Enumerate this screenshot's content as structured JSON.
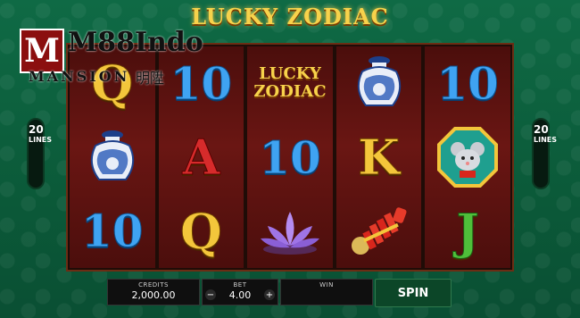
{
  "game_title": "LUCKY ZODIAC",
  "logo": {
    "brand": "M88Indo",
    "sub": "MANSION",
    "chinese": "明陞"
  },
  "paylines": {
    "left": {
      "count": "20",
      "label": "LINES"
    },
    "right": {
      "count": "20",
      "label": "LINES"
    }
  },
  "reels": [
    [
      "Q",
      "vase-icon",
      "10"
    ],
    [
      "10",
      "A",
      "Q"
    ],
    [
      "lucky-zodiac-logo",
      "10",
      "lotus-icon"
    ],
    [
      "vase-icon",
      "K",
      "firecracker-icon"
    ],
    [
      "10",
      "rat-icon",
      "J"
    ]
  ],
  "reel_logo_text": [
    "LUCKY",
    "ZODIAC"
  ],
  "panel": {
    "credits_label": "CREDITS",
    "credits_value": "2,000.00",
    "bet_label": "BET",
    "bet_value": "4.00",
    "win_label": "WIN",
    "win_value": "",
    "minus": "−",
    "plus": "+",
    "spin_label": "SPIN"
  },
  "colors": {
    "felt": "#0f6a45",
    "reel": "#6a1613",
    "ten": "#3fa3f2",
    "gold": "#f3c63b"
  }
}
